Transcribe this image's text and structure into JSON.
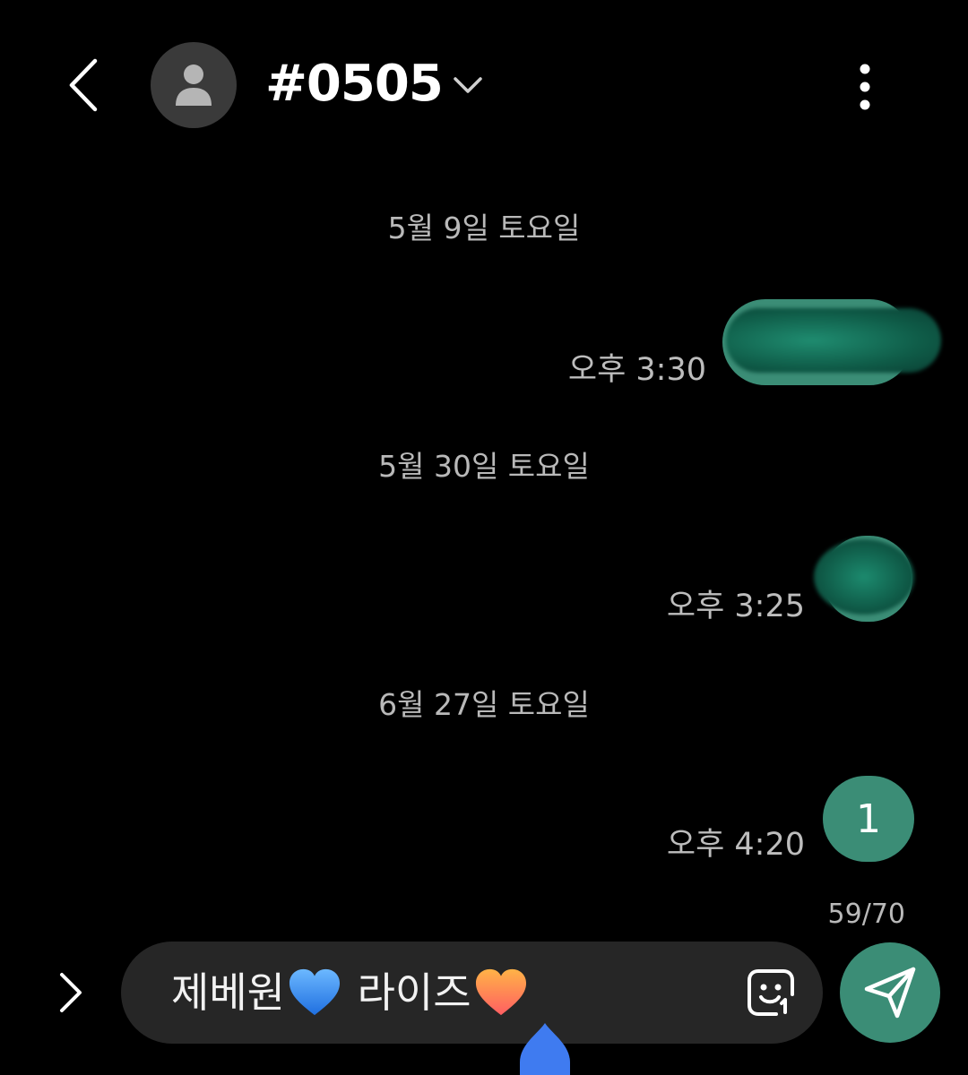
{
  "header": {
    "contact_name": "#0505"
  },
  "messages": {
    "dates": [
      "5월 9일 토요일",
      "5월 30일 토요일",
      "6월 27일 토요일"
    ],
    "times": [
      "오후 3:30",
      "오후 3:25",
      "오후 4:20"
    ],
    "last_message_text": "1"
  },
  "composer": {
    "char_counter": "59/70",
    "text_part1": "제베원",
    "text_part2": " 라이즈"
  },
  "colors": {
    "bubble": "#3b8d76",
    "background": "#000000",
    "input_background": "#262626"
  },
  "icons": {
    "back": "back-arrow-icon",
    "avatar": "person-icon",
    "dropdown": "chevron-down-icon",
    "more": "more-vertical-icon",
    "expand": "chevron-right-icon",
    "sticker": "sticker-icon",
    "send": "send-icon"
  }
}
